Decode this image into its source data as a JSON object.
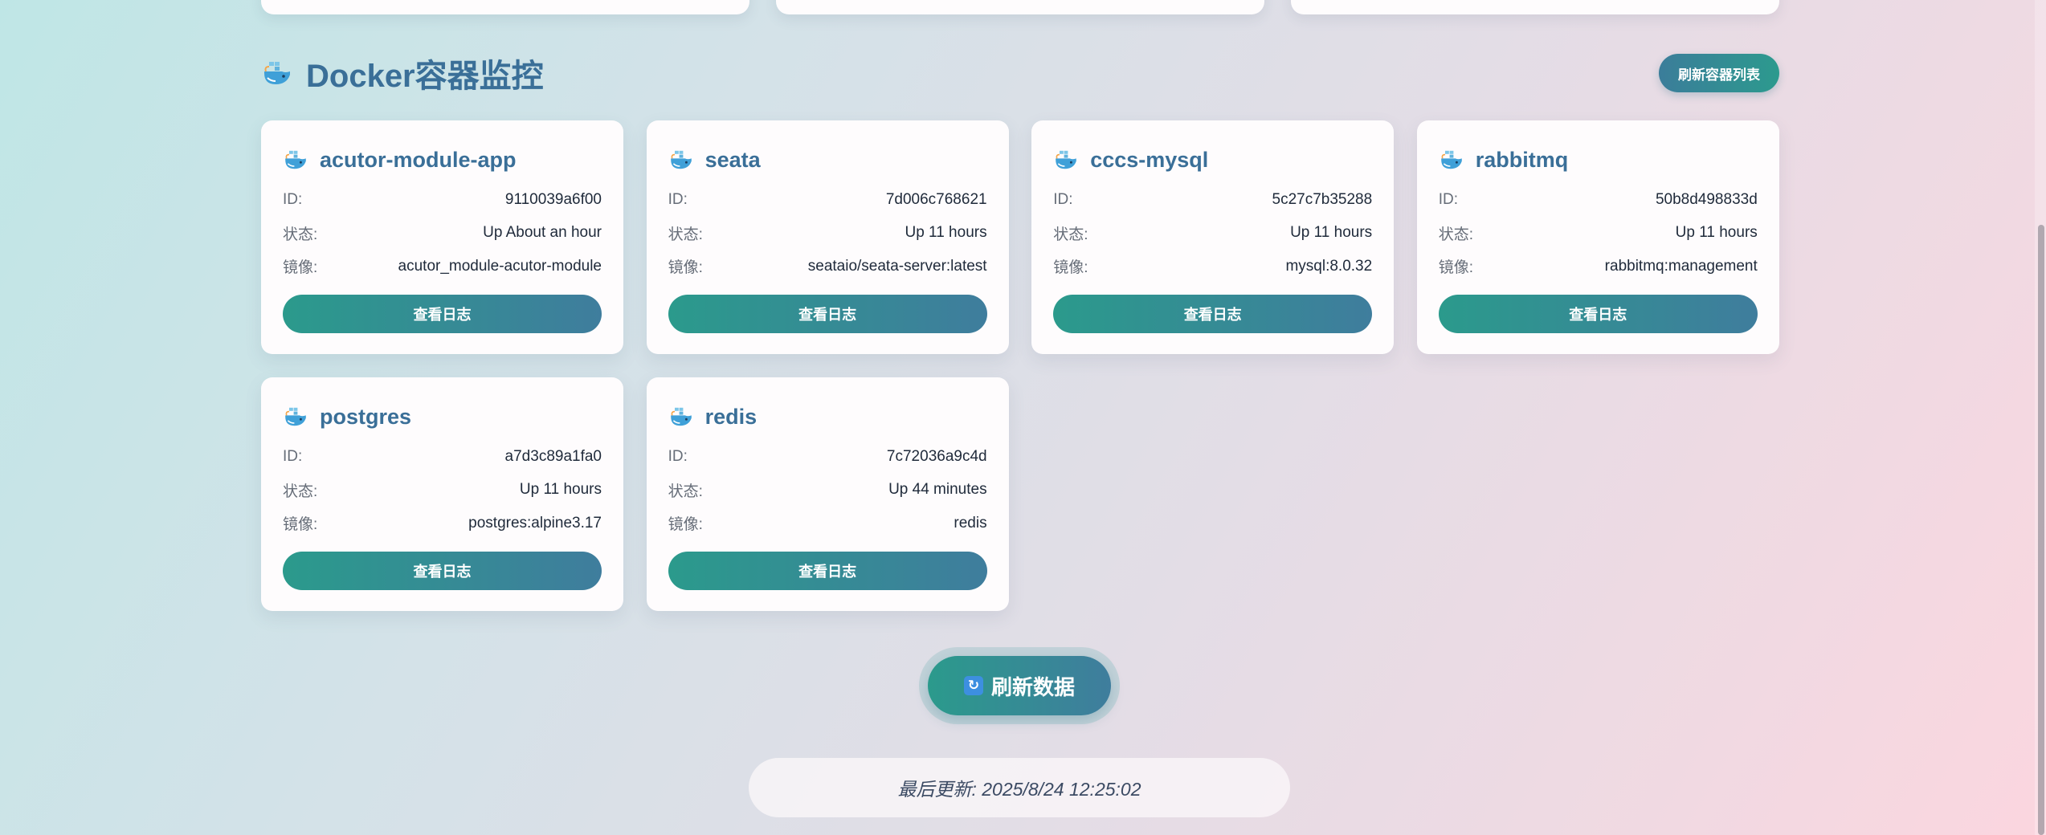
{
  "section": {
    "title": "Docker容器监控",
    "refresh_list_label": "刷新容器列表"
  },
  "labels": {
    "id": "ID:",
    "status": "状态:",
    "image": "镜像:",
    "view_logs": "查看日志"
  },
  "containers": [
    {
      "name": "acutor-module-app",
      "id": "9110039a6f00",
      "status": "Up About an hour",
      "image": "acutor_module-acutor-module"
    },
    {
      "name": "seata",
      "id": "7d006c768621",
      "status": "Up 11 hours",
      "image": "seataio/seata-server:latest"
    },
    {
      "name": "cccs-mysql",
      "id": "5c27c7b35288",
      "status": "Up 11 hours",
      "image": "mysql:8.0.32"
    },
    {
      "name": "rabbitmq",
      "id": "50b8d498833d",
      "status": "Up 11 hours",
      "image": "rabbitmq:management"
    },
    {
      "name": "postgres",
      "id": "a7d3c89a1fa0",
      "status": "Up 11 hours",
      "image": "postgres:alpine3.17"
    },
    {
      "name": "redis",
      "id": "7c72036a9c4d",
      "status": "Up 44 minutes",
      "image": "redis"
    }
  ],
  "refresh_button": {
    "label": "刷新数据",
    "icon": "refresh-cycle-icon"
  },
  "footer": {
    "last_update": "最后更新: 2025/8/24 12:25:02"
  },
  "colors": {
    "accent_start": "#2b9a8c",
    "accent_end": "#3f7d9d",
    "title": "#3a6f98"
  }
}
